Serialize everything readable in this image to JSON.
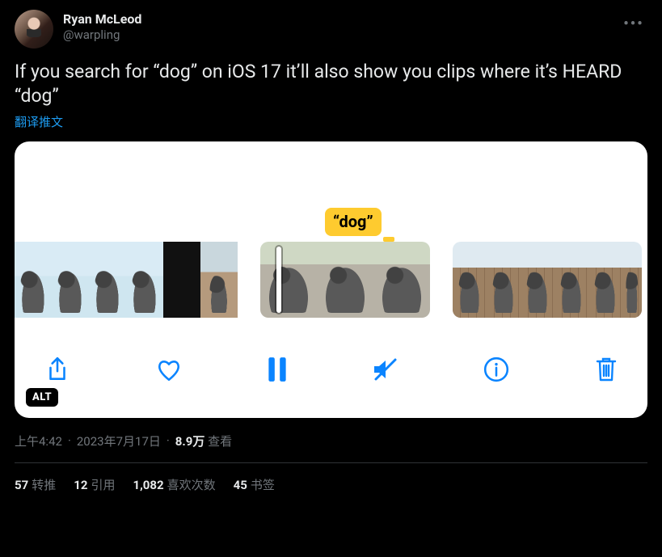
{
  "author": {
    "display_name": "Ryan McLeod",
    "handle": "@warpling"
  },
  "tweet_text": "If you search for “dog” on iOS 17 it’ll also show you clips where it’s HEARD “dog”",
  "translate_label": "翻译推文",
  "media": {
    "caption_tag": "“dog”",
    "alt_badge": "ALT",
    "controls": {
      "share": "share",
      "like": "like",
      "pause": "pause",
      "mute": "mute",
      "info": "info",
      "delete": "delete"
    }
  },
  "meta": {
    "time": "上午4:42",
    "date": "2023年7月17日",
    "views_count": "8.9万",
    "views_label": "查看"
  },
  "stats": {
    "retweets": {
      "count": "57",
      "label": "转推"
    },
    "quotes": {
      "count": "12",
      "label": "引用"
    },
    "likes": {
      "count": "1,082",
      "label": "喜欢次数"
    },
    "bookmarks": {
      "count": "45",
      "label": "书签"
    }
  }
}
